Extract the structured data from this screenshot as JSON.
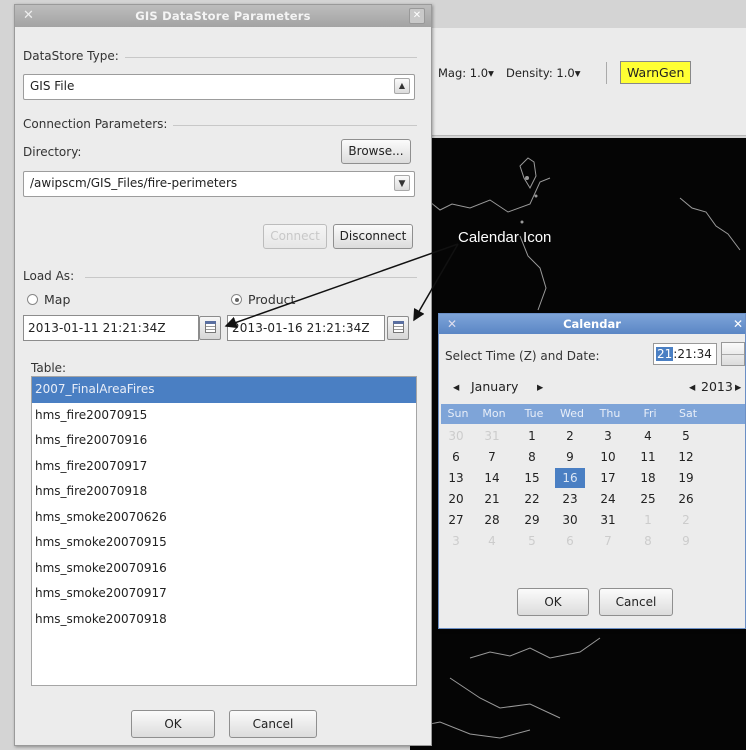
{
  "background": {
    "toolbar": {
      "mag_label": "Mag: 1.0▾",
      "density_label": "Density: 1.0▾",
      "warngen_label": "WarnGen"
    }
  },
  "gis_dialog": {
    "title": "GIS DataStore Parameters",
    "datastore_type": {
      "label": "DataStore Type:",
      "selected": "GIS File"
    },
    "connection": {
      "label": "Connection Parameters:",
      "directory_label": "Directory:",
      "browse_label": "Browse...",
      "directory_value": "/awipscm/GIS_Files/fire-perimeters",
      "connect_label": "Connect",
      "disconnect_label": "Disconnect"
    },
    "load_as": {
      "label": "Load As:",
      "map_label": "Map",
      "product_label": "Product",
      "selected": "Product",
      "start_time": "2013-01-11 21:21:34Z",
      "end_time": "2013-01-16 21:21:34Z"
    },
    "table": {
      "label": "Table:",
      "rows": [
        "2007_FinalAreaFires",
        "hms_fire20070915",
        "hms_fire20070916",
        "hms_fire20070917",
        "hms_fire20070918",
        "hms_smoke20070626",
        "hms_smoke20070915",
        "hms_smoke20070916",
        "hms_smoke20070917",
        "hms_smoke20070918"
      ],
      "selected_index": 0
    },
    "ok_label": "OK",
    "cancel_label": "Cancel"
  },
  "calendar_dialog": {
    "title": "Calendar",
    "time_label": "Select Time (Z) and Date:",
    "time_hour": "21",
    "time_rest": ":21:34",
    "month": "January",
    "year": "2013",
    "weekdays": [
      "Sun",
      "Mon",
      "Tue",
      "Wed",
      "Thu",
      "Fri",
      "Sat"
    ],
    "weeks": [
      [
        "30",
        "31",
        "1",
        "2",
        "3",
        "4",
        "5"
      ],
      [
        "6",
        "7",
        "8",
        "9",
        "10",
        "11",
        "12"
      ],
      [
        "13",
        "14",
        "15",
        "16",
        "17",
        "18",
        "19"
      ],
      [
        "20",
        "21",
        "22",
        "23",
        "24",
        "25",
        "26"
      ],
      [
        "27",
        "28",
        "29",
        "30",
        "31",
        "1",
        "2"
      ],
      [
        "3",
        "4",
        "5",
        "6",
        "7",
        "8",
        "9"
      ]
    ],
    "selected_day": "16",
    "ok_label": "OK",
    "cancel_label": "Cancel"
  },
  "annotation": {
    "text": "Calendar Icon"
  },
  "colors": {
    "selection": "#4a7fc3",
    "calendar_header": "#7ea4d8",
    "warngen": "#ffff33"
  }
}
